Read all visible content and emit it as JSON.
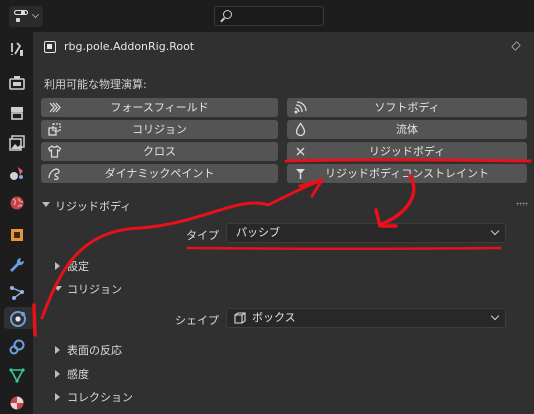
{
  "header": {
    "editor_type_icon": "properties-editor-icon",
    "search_icon": "search-icon"
  },
  "tabs": [
    {
      "name": "tool-tab",
      "icon": "wrench-screwdriver-icon"
    },
    {
      "name": "render-tab",
      "icon": "camera-back-icon"
    },
    {
      "name": "output-tab",
      "icon": "printer-icon"
    },
    {
      "name": "view-layer-tab",
      "icon": "image-stack-icon"
    },
    {
      "name": "scene-tab",
      "icon": "scene-icon"
    },
    {
      "name": "world-tab",
      "icon": "globe-icon"
    },
    {
      "name": "object-tab",
      "icon": "cube-icon"
    },
    {
      "name": "modifier-tab",
      "icon": "wrench-icon"
    },
    {
      "name": "particles-tab",
      "icon": "particles-icon"
    },
    {
      "name": "physics-tab",
      "icon": "physics-orbit-icon",
      "active": true
    },
    {
      "name": "constraints-tab",
      "icon": "constraint-icon"
    },
    {
      "name": "data-tab",
      "icon": "mesh-data-icon"
    },
    {
      "name": "material-tab",
      "icon": "material-sphere-icon"
    }
  ],
  "object": {
    "name": "rbg.pole.AddonRig.Root"
  },
  "physics": {
    "available_label": "利用可能な物理演算:",
    "buttons": [
      {
        "label": "フォースフィールド",
        "icon": "force-field-icon",
        "column": 1,
        "row": 1
      },
      {
        "label": "ソフトボディ",
        "icon": "soft-body-icon",
        "column": 2,
        "row": 1
      },
      {
        "label": "コリジョン",
        "icon": "collision-icon",
        "column": 1,
        "row": 2
      },
      {
        "label": "流体",
        "icon": "fluid-drop-icon",
        "column": 2,
        "row": 2
      },
      {
        "label": "クロス",
        "icon": "cloth-shirt-icon",
        "column": 1,
        "row": 3
      },
      {
        "label": "リジッドボディ",
        "icon": "close-x-icon",
        "column": 2,
        "row": 3
      },
      {
        "label": "ダイナミックペイント",
        "icon": "dynamic-paint-icon",
        "column": 1,
        "row": 4
      },
      {
        "label": "リジッドボディコンストレイント",
        "icon": "rigid-constraint-icon",
        "column": 2,
        "row": 4
      }
    ]
  },
  "rigid_body": {
    "title": "リジッドボディ",
    "type_label": "タイプ",
    "type_value": "パッシブ",
    "subpanels": {
      "settings": "設定",
      "collision": "コリジョン",
      "surface_response": "表面の反応",
      "sensitivity": "感度",
      "collection": "コレクション"
    },
    "shape_label": "シェイプ",
    "shape_value": "ボックス",
    "shape_icon": "box-shape-icon"
  },
  "annotation": {
    "color": "#e8101a"
  }
}
